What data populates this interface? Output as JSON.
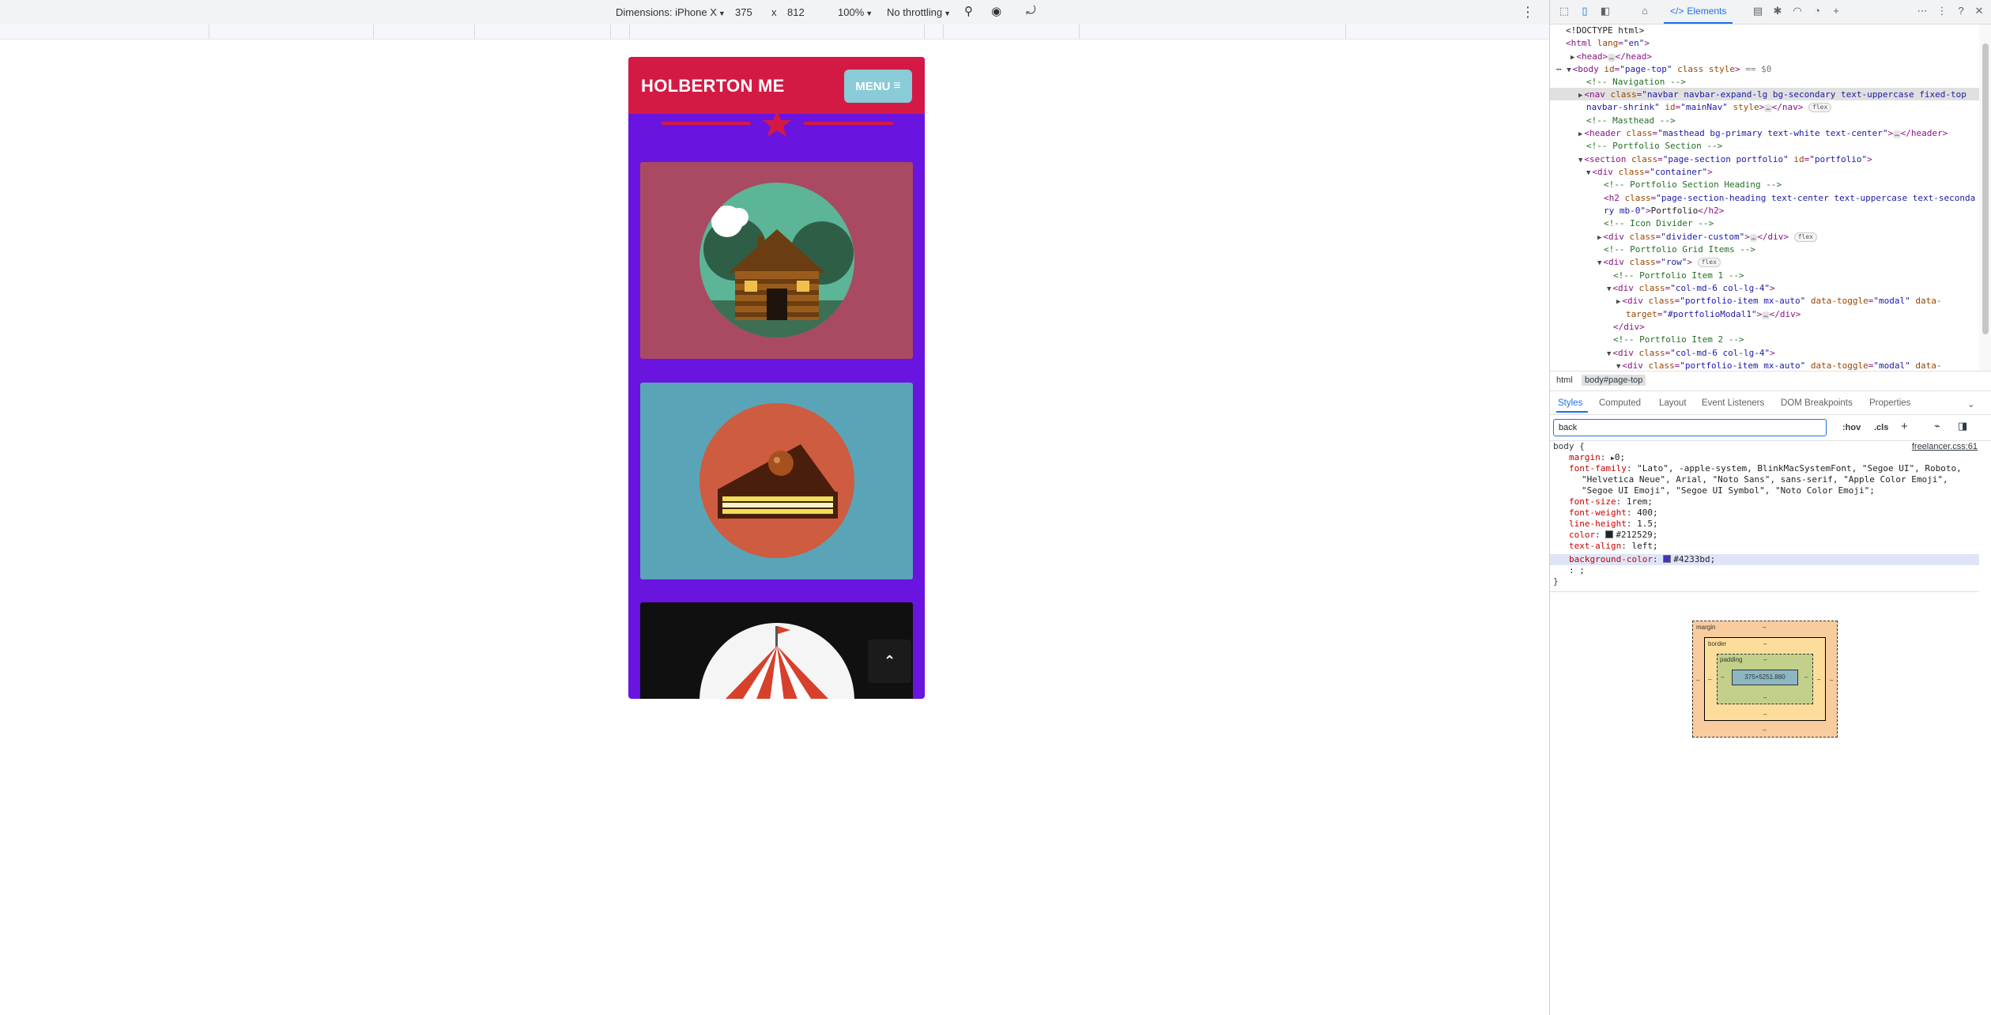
{
  "device_toolbar": {
    "dimensions_label": "Dimensions: iPhone X",
    "width": "375",
    "times": "x",
    "height": "812",
    "zoom": "100%",
    "throttling": "No throttling"
  },
  "phone": {
    "brand": "HOLBERTON ME",
    "menu_label": "MENU",
    "nav_color": "#d41a44",
    "body_background": "#4233bd",
    "cards": [
      {
        "name": "cabin",
        "background": "#a94a62"
      },
      {
        "name": "cake",
        "background": "#5aa4b8"
      },
      {
        "name": "circus",
        "background": "#101010"
      }
    ]
  },
  "devtools": {
    "active_tab": "Elements",
    "dom_lines": {
      "l1": "<!DOCTYPE html>",
      "l2_tag": "<html",
      "l2_attr": "lang",
      "l2_val": "\"en\"",
      "l3": "<head>",
      "l3_end": "</head>",
      "l4_tag": "<body",
      "l4_attr1": "id",
      "l4_val1": "\"page-top\"",
      "l4_attr2": "class style",
      "l4_eq": "== $0",
      "l5": "<!-- Navigation -->",
      "l6_tag": "<nav",
      "l6_attr": "class",
      "l6_val": "\"navbar navbar-expand-lg bg-secondary text-uppercase fixed-top",
      "l7_val": "navbar-shrink\"",
      "l7_attr": "id",
      "l7_val2": "\"mainNav\"",
      "l7_rest": "style",
      "l7_end": "</nav>",
      "l8": "<!-- Masthead -->",
      "l9_tag": "<header",
      "l9_attr": "class",
      "l9_val": "\"masthead bg-primary text-white text-center\"",
      "l9_end": "</header>",
      "l10": "<!-- Portfolio Section -->",
      "l11_tag": "<section",
      "l11_attr": "class",
      "l11_val": "\"page-section portfolio\"",
      "l11_attr2": "id",
      "l11_val2": "\"portfolio\"",
      "l12_tag": "<div",
      "l12_attr": "class",
      "l12_val": "\"container\"",
      "l13": "<!-- Portfolio Section Heading -->",
      "l14_tag": "<h2",
      "l14_attr": "class",
      "l14_val": "\"page-section-heading text-center text-uppercase text-seconda",
      "l15_val": "ry mb-0\"",
      "l15_text": "Portfolio",
      "l15_end": "</h2>",
      "l16": "<!-- Icon Divider -->",
      "l17_tag": "<div",
      "l17_attr": "class",
      "l17_val": "\"divider-custom\"",
      "l17_end": "</div>",
      "l18": "<!-- Portfolio Grid Items -->",
      "l19_tag": "<div",
      "l19_attr": "class",
      "l19_val": "\"row\"",
      "l20": "<!-- Portfolio Item 1 -->",
      "l21_tag": "<div",
      "l21_attr": "class",
      "l21_val": "\"col-md-6 col-lg-4\"",
      "l22_tag": "<div",
      "l22_attr": "class",
      "l22_val": "\"portfolio-item mx-auto\"",
      "l22_attr2": "data-toggle",
      "l22_val2": "\"modal\"",
      "l22_attr3": "data-",
      "l23_attr": "target",
      "l23_val": "\"#portfolioModal1\"",
      "l23_end": "</div>",
      "l24": "</div>",
      "l25": "<!-- Portfolio Item 2 -->",
      "l26_tag": "<div",
      "l26_attr": "class",
      "l26_val": "\"col-md-6 col-lg-4\"",
      "l27_tag": "<div",
      "l27_attr": "class",
      "l27_val": "\"portfolio-item mx-auto\"",
      "l27_attr2": "data-toggle",
      "l27_val2": "\"modal\"",
      "l27_attr3": "data-",
      "flex": "flex",
      "ellipsis": "…"
    },
    "breadcrumbs": [
      "html",
      "body#page-top"
    ],
    "sub_tabs": [
      "Styles",
      "Computed",
      "Layout",
      "Event Listeners",
      "DOM Breakpoints",
      "Properties"
    ],
    "filter_value": "back",
    "filter_buttons": {
      "hov": ":hov",
      "cls": ".cls",
      "plus": "+"
    },
    "styles": {
      "selector": "body {",
      "source": "freelancer.css:61",
      "margin_prop": "margin",
      "margin_val": "0;",
      "ff_prop": "font-family",
      "ff_val1": "\"Lato\", -apple-system, BlinkMacSystemFont, \"Segoe UI\", Roboto,",
      "ff_val2": "\"Helvetica Neue\", Arial, \"Noto Sans\", sans-serif, \"Apple Color Emoji\",",
      "ff_val3": "\"Segoe UI Emoji\", \"Segoe UI Symbol\", \"Noto Color Emoji\";",
      "fs_prop": "font-size",
      "fs_val": "1rem;",
      "fw_prop": "font-weight",
      "fw_val": "400;",
      "lh_prop": "line-height",
      "lh_val": "1.5;",
      "color_prop": "color",
      "color_val": "#212529;",
      "ta_prop": "text-align",
      "ta_val": "left;",
      "bg_prop": "background-color",
      "bg_val": "#4233bd;",
      "empty": ": ;",
      "close": "}"
    },
    "box_model": {
      "margin_label": "margin",
      "border_label": "border",
      "padding_label": "padding",
      "content": "375×5251.880",
      "dash": "–"
    }
  }
}
